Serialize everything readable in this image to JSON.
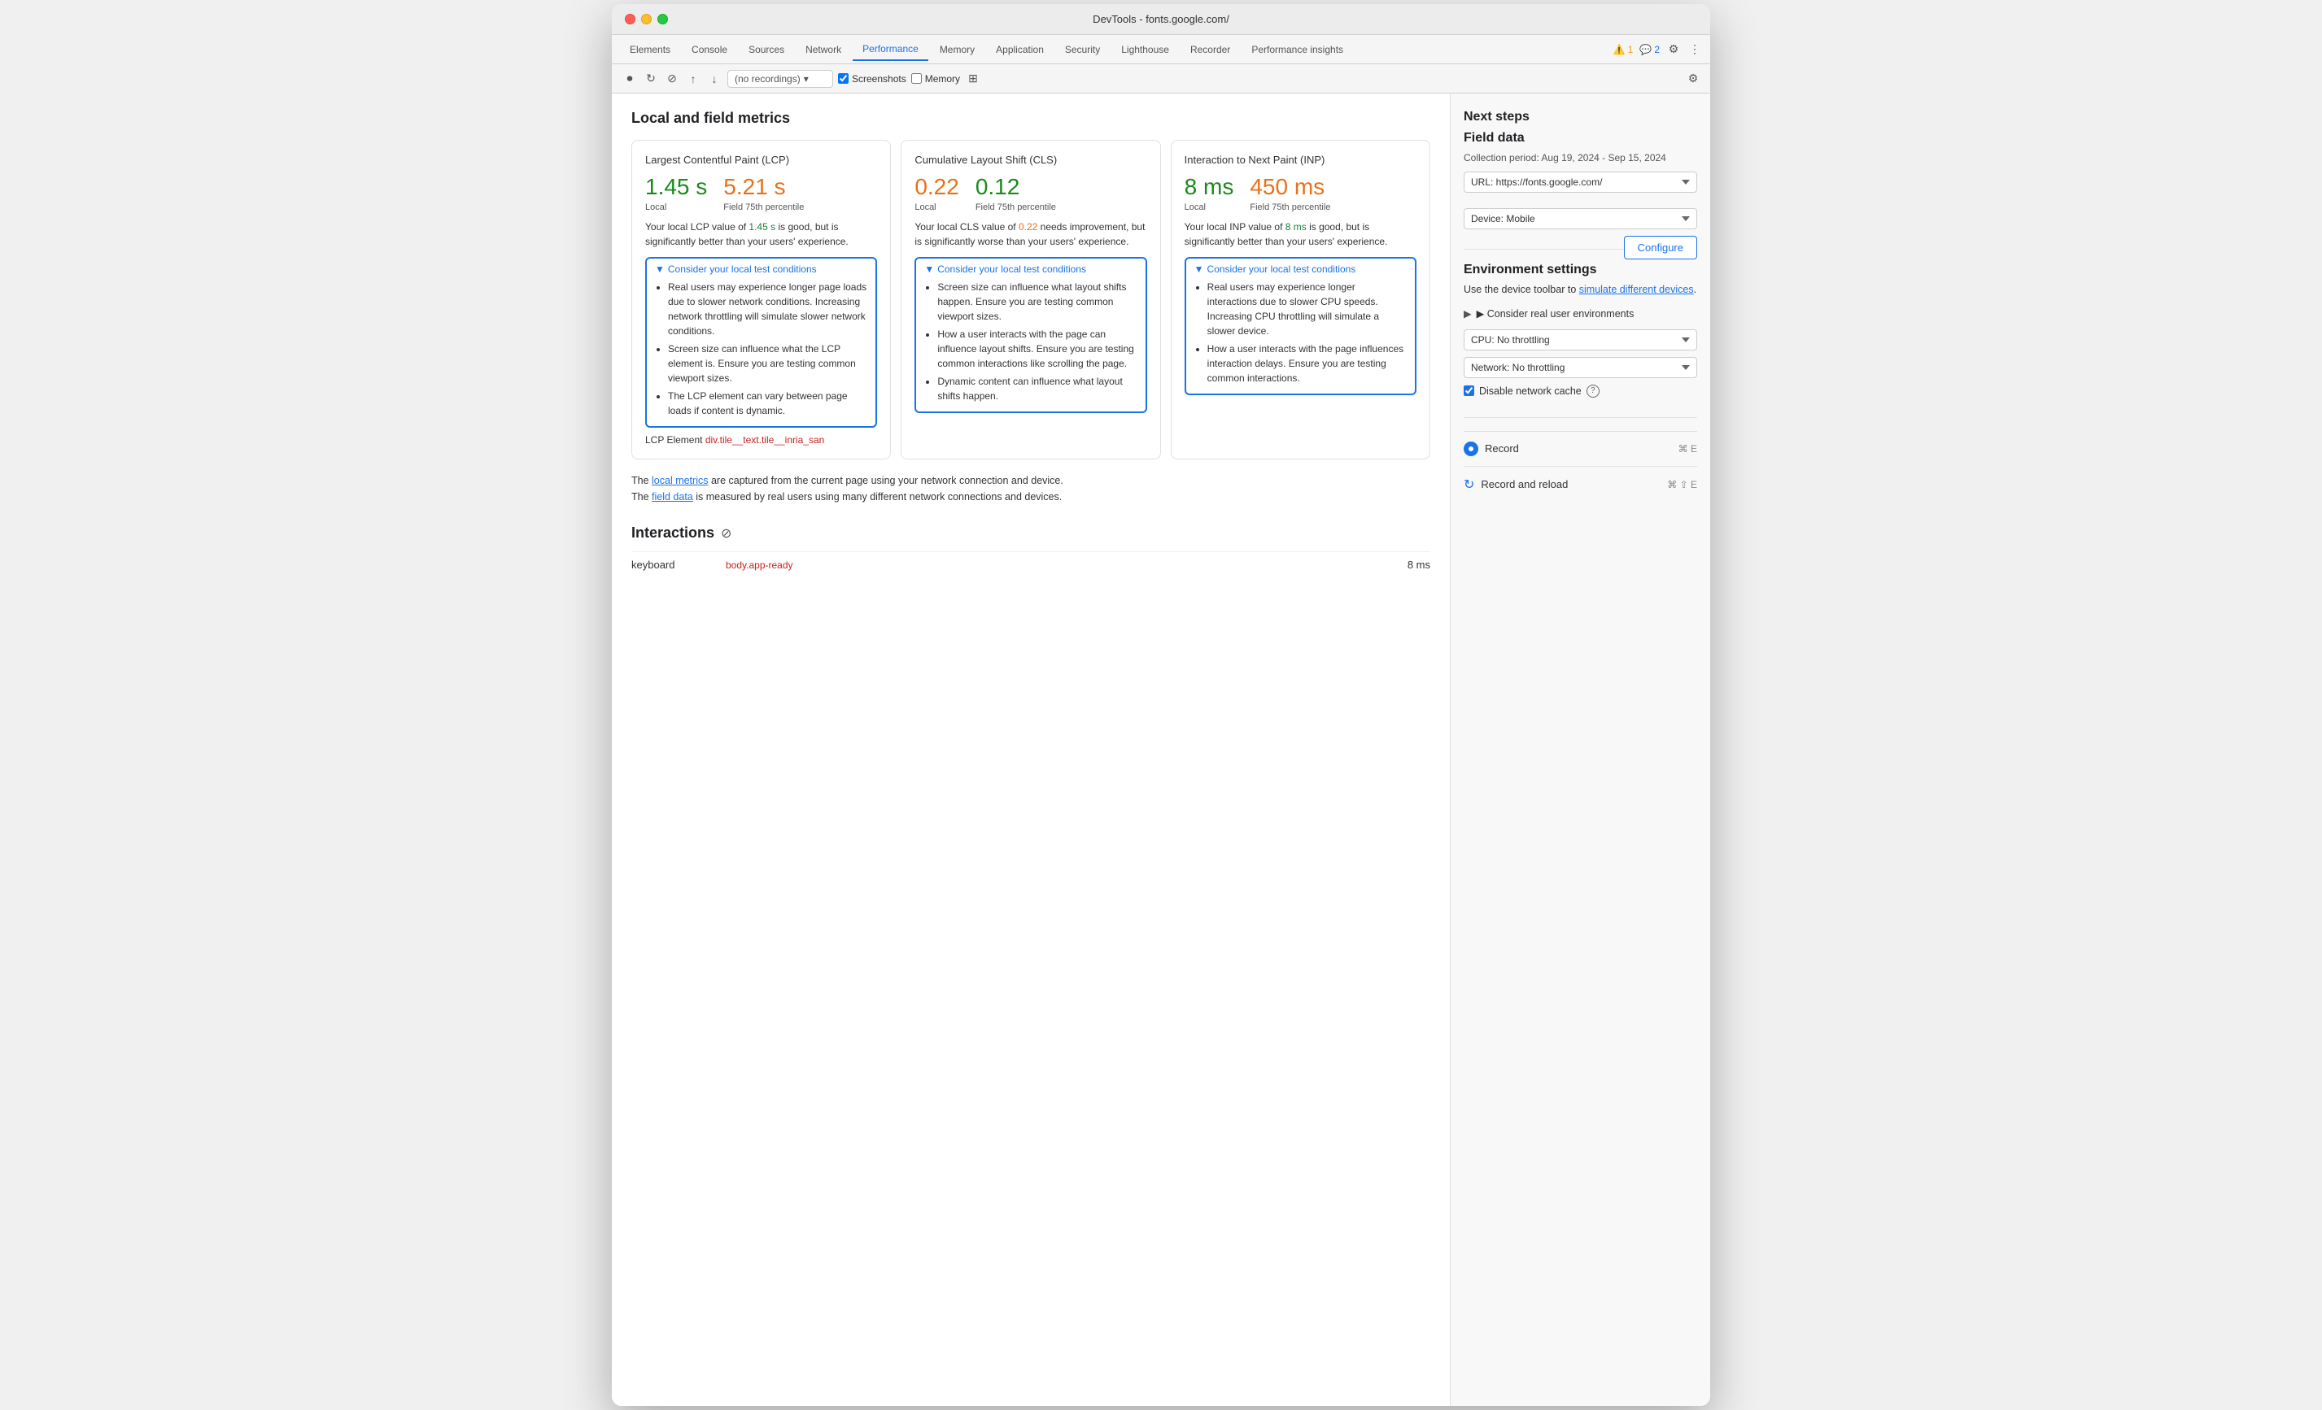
{
  "window": {
    "title": "DevTools - fonts.google.com/"
  },
  "tabs": {
    "items": [
      {
        "label": "Elements",
        "active": false
      },
      {
        "label": "Console",
        "active": false
      },
      {
        "label": "Sources",
        "active": false
      },
      {
        "label": "Network",
        "active": false
      },
      {
        "label": "Performance",
        "active": true
      },
      {
        "label": "Memory",
        "active": false
      },
      {
        "label": "Application",
        "active": false
      },
      {
        "label": "Security",
        "active": false
      },
      {
        "label": "Lighthouse",
        "active": false
      },
      {
        "label": "Recorder",
        "active": false
      },
      {
        "label": "Performance insights",
        "active": false
      }
    ],
    "warnings": "1",
    "errors": "2"
  },
  "toolbar": {
    "no_recordings": "(no recordings)",
    "screenshots_label": "Screenshots",
    "memory_label": "Memory"
  },
  "metrics": {
    "section_title": "Local and field metrics",
    "lcp": {
      "title": "Largest Contentful Paint (LCP)",
      "local_value": "1.45 s",
      "field_value": "5.21 s",
      "local_label": "Local",
      "field_label": "Field 75th percentile",
      "description": "Your local LCP value of 1.45 s is good, but is significantly better than your users' experience.",
      "description_highlight": "1.45 s",
      "consider_title": "▼Consider your local test conditions",
      "bullets": [
        "Real users may experience longer page loads due to slower network conditions. Increasing network throttling will simulate slower network conditions.",
        "Screen size can influence what the LCP element is. Ensure you are testing common viewport sizes.",
        "The LCP element can vary between page loads if content is dynamic."
      ],
      "lcp_element_label": "LCP Element",
      "lcp_element_value": "div.tile__text.tile__inria_san"
    },
    "cls": {
      "title": "Cumulative Layout Shift (CLS)",
      "local_value": "0.22",
      "field_value": "0.12",
      "local_label": "Local",
      "field_label": "Field 75th percentile",
      "description": "Your local CLS value of 0.22 needs improvement, but is significantly worse than your users' experience.",
      "description_highlight_local": "0.22",
      "consider_title": "▼Consider your local test conditions",
      "bullets": [
        "Screen size can influence what layout shifts happen. Ensure you are testing common viewport sizes.",
        "How a user interacts with the page can influence layout shifts. Ensure you are testing common interactions like scrolling the page.",
        "Dynamic content can influence what layout shifts happen."
      ]
    },
    "inp": {
      "title": "Interaction to Next Paint (INP)",
      "local_value": "8 ms",
      "field_value": "450 ms",
      "local_label": "Local",
      "field_label": "Field 75th percentile",
      "description": "Your local INP value of 8 ms is good, but is significantly better than your users' experience.",
      "description_highlight": "8 ms",
      "consider_title": "▼Consider your local test conditions",
      "bullets": [
        "Real users may experience longer interactions due to slower CPU speeds. Increasing CPU throttling will simulate a slower device.",
        "How a user interacts with the page influences interaction delays. Ensure you are testing common interactions."
      ]
    }
  },
  "footer": {
    "text1": "The local metrics are captured from the current page using your network connection and device.",
    "text2": "The field data is measured by real users using many different network connections and devices.",
    "local_metrics_link": "local metrics",
    "field_data_link": "field data"
  },
  "interactions": {
    "title": "Interactions",
    "rows": [
      {
        "name": "keyboard",
        "selector": "body.app-ready",
        "time": "8 ms"
      }
    ]
  },
  "next_steps": {
    "title": "Next steps",
    "field_data": {
      "title": "Field data",
      "period": "Collection period: Aug 19, 2024 - Sep 15, 2024",
      "url_label": "URL: https://fonts.google.com/",
      "device_label": "Device: Mobile",
      "configure_btn": "Configure"
    },
    "environment": {
      "title": "Environment settings",
      "description_text": "Use the device toolbar to",
      "simulate_link": "simulate different devices",
      "description_end": ".",
      "consider_real_label": "▶ Consider real user environments",
      "cpu_label": "CPU: No throttling",
      "network_label": "Network: No throttling",
      "disable_cache_label": "Disable network cache"
    },
    "record": {
      "label": "Record",
      "shortcut": "⌘ E"
    },
    "record_reload": {
      "label": "Record and reload",
      "shortcut": "⌘ ⇧ E"
    }
  }
}
